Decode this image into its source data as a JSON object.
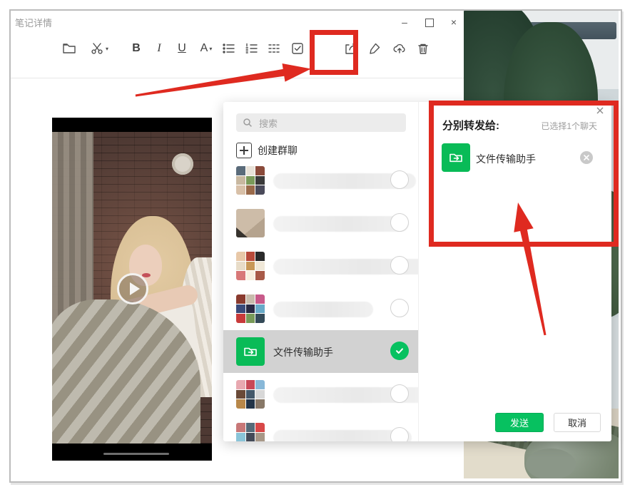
{
  "window": {
    "title": "笔记详情",
    "controls": {
      "minimize": "–",
      "close": "×"
    }
  },
  "toolbar": {
    "bold": "B",
    "italic": "I",
    "underline": "U",
    "font_color": "A",
    "caret": "▾"
  },
  "dialog": {
    "search_placeholder": "搜索",
    "create_group_label": "创建群聊",
    "contacts": [
      {
        "kind": "group",
        "redacted": true,
        "redact_width": 200,
        "tiles": [
          "#5a6b7a",
          "#e8e2d8",
          "#8a4a3a",
          "#c8b8a0",
          "#7a9a5a",
          "#3a3a3a",
          "#d8c0a8",
          "#9a6a4a",
          "#4a4a5a"
        ]
      },
      {
        "kind": "photo",
        "redacted": true,
        "redact_width": 190,
        "tiles": []
      },
      {
        "kind": "group",
        "redacted": true,
        "redact_width": 232,
        "tiles": [
          "#e8c8a8",
          "#b84a3a",
          "#2a2a2a",
          "#e8dcc8",
          "#c89858",
          "#f0e8d8",
          "#d87878",
          "#f8f0e0",
          "#a85a48"
        ]
      },
      {
        "kind": "group",
        "redacted": true,
        "redact_width": 140,
        "tiles": [
          "#8a3a2e",
          "#c8bcac",
          "#c85a8a",
          "#3a4a7a",
          "#2a2a44",
          "#68aac8",
          "#c83a3a",
          "#789a58",
          "#344a58"
        ]
      },
      {
        "kind": "service",
        "name": "文件传输助手",
        "selected": true,
        "redacted": false,
        "tiles": []
      },
      {
        "kind": "group",
        "redacted": true,
        "redact_width": 214,
        "tiles": [
          "#e8a8b0",
          "#c84858",
          "#88b8d8",
          "#6a4a38",
          "#44586a",
          "#d8d8d8",
          "#b8884a",
          "#223448",
          "#887868"
        ]
      },
      {
        "kind": "group",
        "redacted": true,
        "redact_width": 194,
        "tiles": [
          "#c87878",
          "#566a78",
          "#d84848",
          "#8ac4d8",
          "#444a58",
          "#a89888",
          "#35586a",
          "#c0d8e0",
          "#655a48"
        ]
      }
    ],
    "panel": {
      "title": "分别转发给:",
      "selected_info": "已选择1个聊天",
      "items": [
        {
          "name": "文件传输助手"
        }
      ],
      "send_label": "发送",
      "cancel_label": "取消"
    }
  },
  "colors": {
    "wechat_green": "#07C160",
    "service_icon_green": "#09bb57",
    "annotation_red": "#df2a20",
    "selected_row_bg": "#d2d2d2"
  }
}
